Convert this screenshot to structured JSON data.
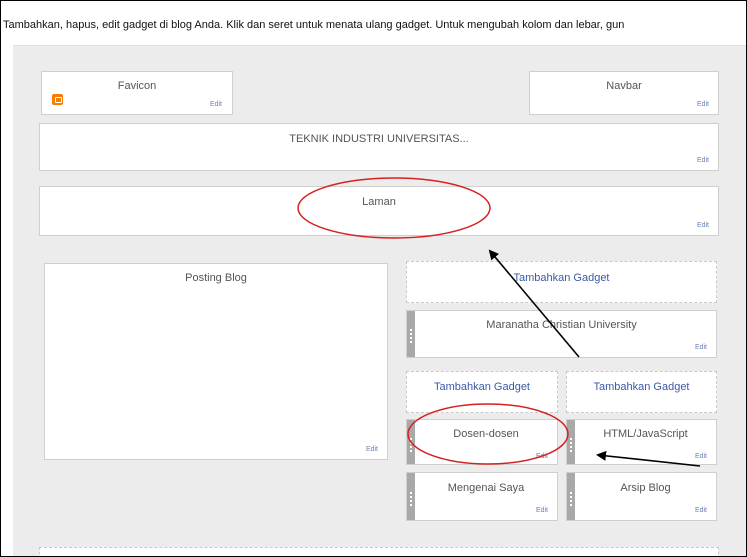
{
  "instruction": "Tambahkan, hapus, edit gadget di blog Anda. Klik dan seret untuk menata ulang gadget. Untuk mengubah kolom dan lebar, gun",
  "edit_label": "Edit",
  "header": {
    "favicon": "Favicon",
    "navbar": "Navbar",
    "blog_title": "TEKNIK INDUSTRI UNIVERSITAS...",
    "pages": "Laman"
  },
  "main": {
    "posts": "Posting Blog"
  },
  "sidebar": {
    "add_gadget": "Tambahkan Gadget",
    "maranatha": "Maranatha Christian University",
    "dosen": "Dosen-dosen",
    "html_js": "HTML/JavaScript",
    "about": "Mengenai Saya",
    "archive": "Arsip Blog"
  },
  "colors": {
    "annotation": "#d62020",
    "link": "#3b5aa8",
    "grip": "#a9a9a9"
  }
}
